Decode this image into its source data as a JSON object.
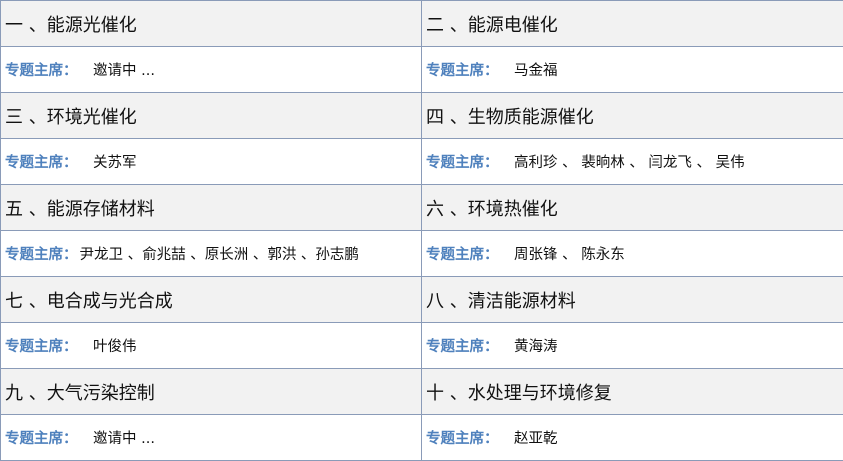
{
  "chair_label": "专题主席：",
  "accent_color": "#4f81bd",
  "sessions": [
    {
      "title": "一 、能源光催化",
      "chairs": "邀请中 ..."
    },
    {
      "title": "二 、能源电催化",
      "chairs": "马金福"
    },
    {
      "title": "三 、环境光催化",
      "chairs": "关苏军"
    },
    {
      "title": "四 、生物质能源催化",
      "chairs": "高利珍 、 裴晌林 、 闫龙飞 、 吴伟"
    },
    {
      "title": "五 、能源存储材料",
      "chairs": "尹龙卫 、俞兆喆 、原长洲 、郭洪 、孙志鹏"
    },
    {
      "title": "六 、环境热催化",
      "chairs": "周张锋 、 陈永东"
    },
    {
      "title": "七 、电合成与光合成",
      "chairs": "叶俊伟"
    },
    {
      "title": "八 、清洁能源材料",
      "chairs": "黄海涛"
    },
    {
      "title": "九 、大气污染控制",
      "chairs": "邀请中 ..."
    },
    {
      "title": "十 、水处理与环境修复",
      "chairs": "赵亚乾"
    }
  ]
}
